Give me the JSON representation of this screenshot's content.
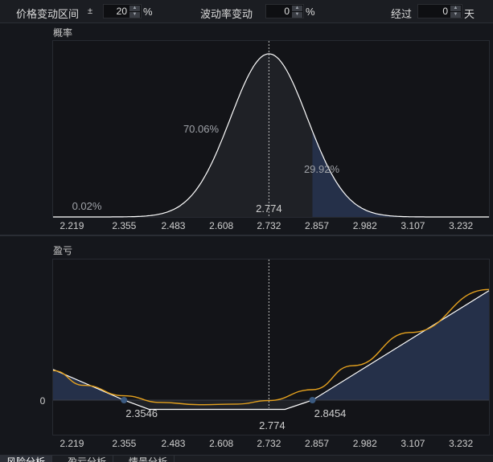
{
  "toolbar": {
    "price_range_label": "价格变动区间",
    "plus_minus": "±",
    "price_range_value": "20",
    "percent_sign_1": "%",
    "vol_change_label": "波动率变动",
    "vol_change_value": "0",
    "percent_sign_2": "%",
    "elapsed_label": "经过",
    "elapsed_value": "0",
    "days_unit": "天"
  },
  "prob_panel": {
    "title": "概率"
  },
  "pnl_panel": {
    "title": "盈亏"
  },
  "tabs": [
    {
      "label": "风险分析"
    },
    {
      "label": "盈亏分析"
    },
    {
      "label": "情景分析"
    }
  ],
  "colors": {
    "background": "#15171c",
    "plot_bg": "#131418",
    "gray_fill": "#1f2126",
    "blue_fill": "#253049",
    "curve_white": "#ffffff",
    "curve_orange": "#e6a21e",
    "marker": "#3b5a80"
  },
  "chart_data": [
    {
      "type": "area",
      "title": "概率",
      "x_ticks": [
        "2.219",
        "2.355",
        "2.483",
        "2.608",
        "2.732",
        "2.857",
        "2.982",
        "3.107",
        "3.232"
      ],
      "xlim": [
        2.17,
        3.305
      ],
      "distribution": {
        "mean": 2.732,
        "sd": 0.1
      },
      "current_price": 2.774,
      "current_price_label": "2.774",
      "upper_threshold": 2.8454,
      "regions": [
        {
          "label": "0.02%",
          "value": 0.02
        },
        {
          "label": "70.06%",
          "value": 70.06
        },
        {
          "label": "29.92%",
          "value": 29.92
        }
      ]
    },
    {
      "type": "line",
      "title": "盈亏",
      "x_ticks": [
        "2.219",
        "2.355",
        "2.483",
        "2.608",
        "2.732",
        "2.857",
        "2.982",
        "3.107",
        "3.232"
      ],
      "xlim": [
        2.17,
        3.305
      ],
      "y_ticks": [
        "0"
      ],
      "current_price_label": "2.774",
      "breakevens": [
        {
          "x": 2.3546,
          "label": "2.3546"
        },
        {
          "x": 2.8454,
          "label": "2.8454"
        }
      ],
      "series": [
        {
          "style": "expiry",
          "x": [
            2.17,
            2.3546,
            2.42,
            2.774,
            2.8454,
            3.305
          ],
          "y": [
            0.025,
            0,
            -0.0075,
            -0.0075,
            0,
            0.089
          ]
        },
        {
          "style": "current",
          "x": [
            2.17,
            2.25,
            2.3546,
            2.45,
            2.55,
            2.65,
            2.73,
            2.8454,
            2.95,
            3.1,
            3.305
          ],
          "y": [
            0.024,
            0.012,
            0.0035,
            -0.0018,
            -0.0037,
            -0.0032,
            -0.0004,
            0.0085,
            0.028,
            0.055,
            0.09
          ]
        }
      ]
    }
  ]
}
